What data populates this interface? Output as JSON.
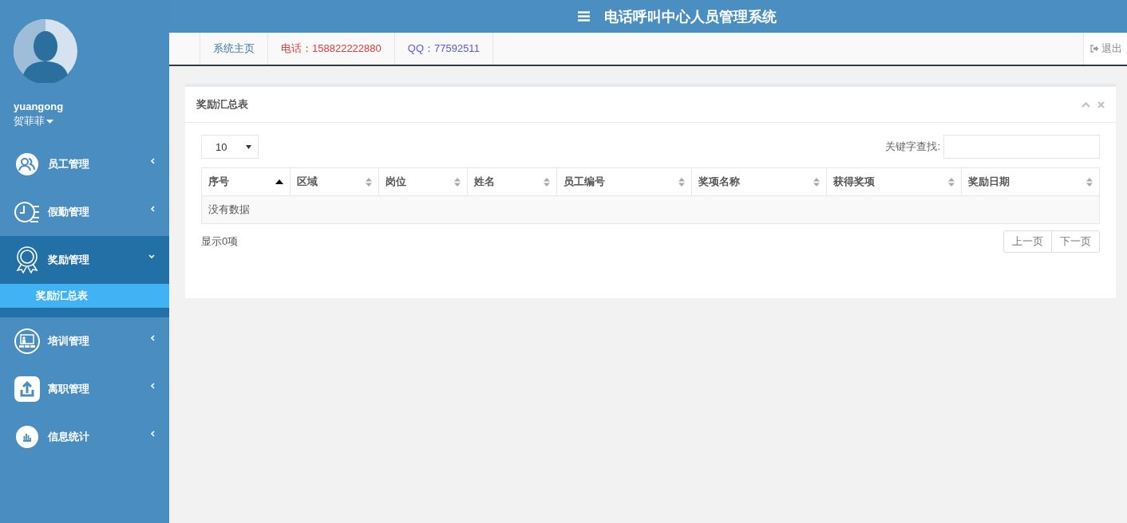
{
  "sidebar": {
    "user": {
      "username": "yuangong",
      "display_name": "贺菲菲"
    },
    "menu": [
      {
        "label": "员工管理",
        "kind": "people",
        "expanded": false
      },
      {
        "label": "假勤管理",
        "kind": "clock",
        "expanded": false
      },
      {
        "label": "奖励管理",
        "kind": "medal",
        "expanded": true,
        "children": [
          {
            "label": "奖励汇总表",
            "selected": true
          }
        ]
      },
      {
        "label": "培训管理",
        "kind": "training",
        "expanded": false
      },
      {
        "label": "离职管理",
        "kind": "upload",
        "expanded": false
      },
      {
        "label": "信息统计",
        "kind": "chart",
        "expanded": false
      }
    ]
  },
  "header": {
    "title": "电话呼叫中心人员管理系统"
  },
  "nav": {
    "links": [
      {
        "label": "系统主页",
        "kind": "home"
      },
      {
        "label": "电话：158822222880",
        "kind": "phone"
      },
      {
        "label": "QQ：77592511",
        "kind": "qq"
      }
    ],
    "logout": "退出"
  },
  "panel": {
    "title": "奖励汇总表",
    "page_size": "10",
    "search_label": "关键字查找:",
    "columns": [
      {
        "label": "序号",
        "sorted": true
      },
      {
        "label": "区域",
        "sorted": false
      },
      {
        "label": "岗位",
        "sorted": false
      },
      {
        "label": "姓名",
        "sorted": false
      },
      {
        "label": "员工编号",
        "sorted": false
      },
      {
        "label": "奖项名称",
        "sorted": false
      },
      {
        "label": "获得奖项",
        "sorted": false
      },
      {
        "label": "奖励日期",
        "sorted": false
      }
    ],
    "empty_text": "没有数据",
    "info": "显示0项",
    "pager": [
      "上一页",
      "下一页"
    ]
  }
}
